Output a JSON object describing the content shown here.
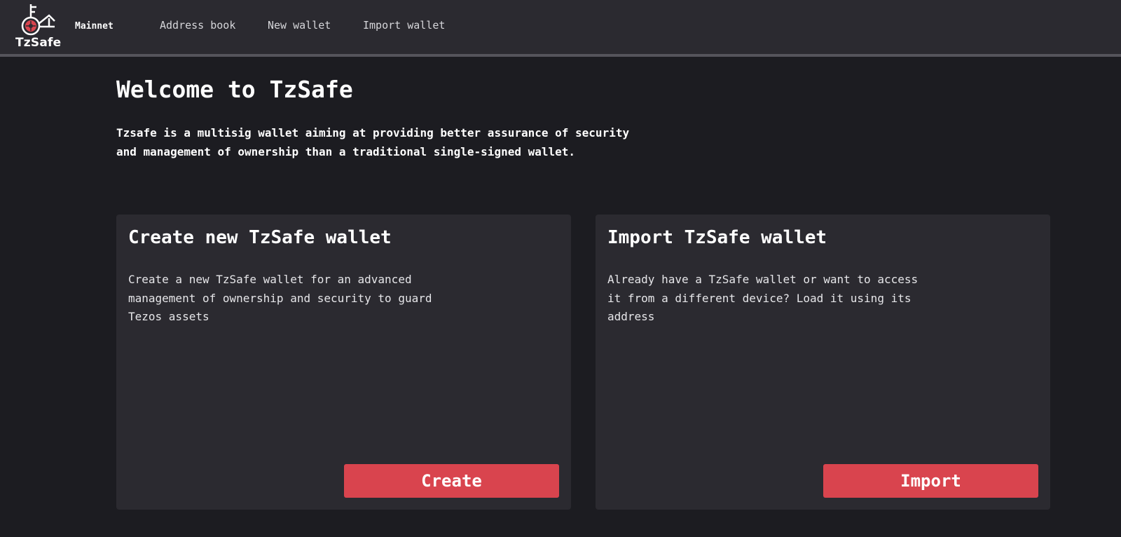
{
  "header": {
    "logo_text": "TzSafe",
    "network": "Mainnet",
    "nav": {
      "address_book": "Address book",
      "new_wallet": "New wallet",
      "import_wallet": "Import wallet"
    }
  },
  "main": {
    "title": "Welcome to TzSafe",
    "intro": "Tzsafe is a multisig wallet aiming at providing better assurance of security and management of ownership than a traditional single-signed wallet.",
    "cards": {
      "create": {
        "title": "Create new TzSafe wallet",
        "description": "Create a new TzSafe wallet for an advanced management of ownership and security to guard Tezos assets",
        "button": "Create"
      },
      "import": {
        "title": "Import TzSafe wallet",
        "description": "Already have a TzSafe wallet or want to access it from a different device? Load it using its address",
        "button": "Import"
      }
    }
  },
  "colors": {
    "background": "#1c1c21",
    "surface": "#2b2a30",
    "accent": "#d9444e",
    "divider": "#55545b"
  },
  "icons": {
    "logo": "key-shield-logo-icon"
  }
}
